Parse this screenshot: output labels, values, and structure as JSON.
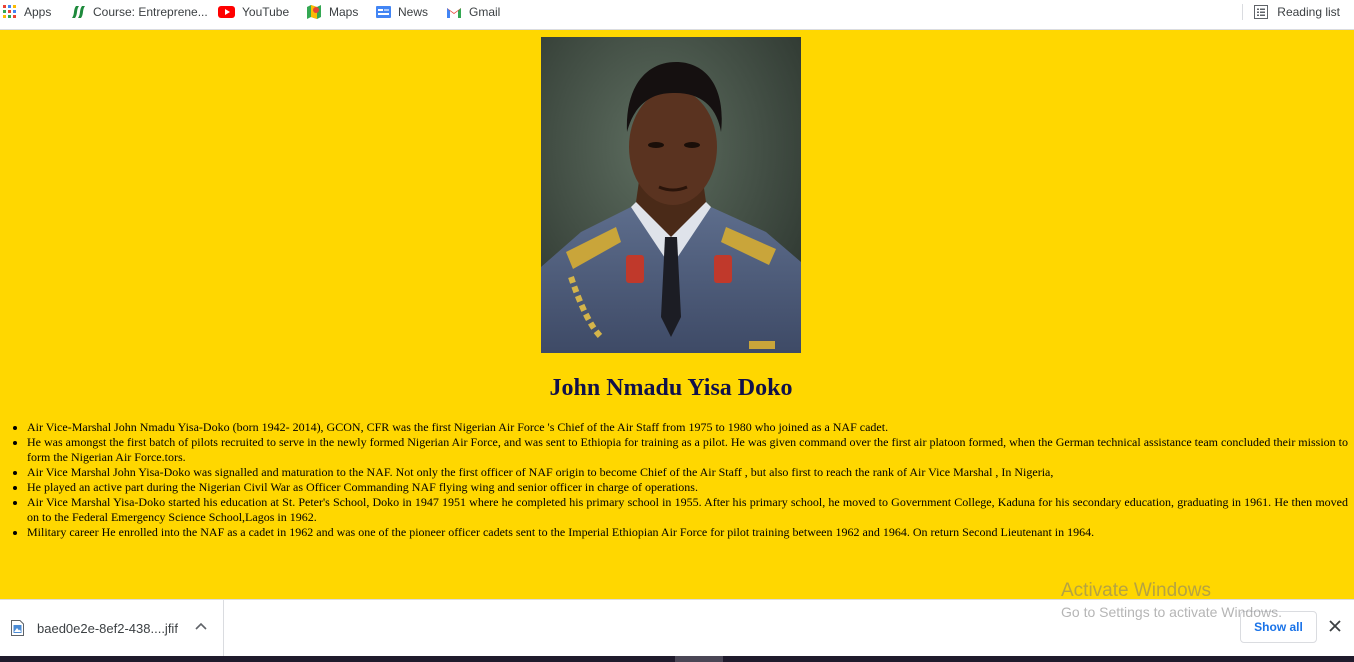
{
  "bookmarks_bar": {
    "items": [
      {
        "label": "Apps",
        "icon": "apps-grid-icon"
      },
      {
        "label": "Course: Entreprene...",
        "icon": "course-logo-icon"
      },
      {
        "label": "YouTube",
        "icon": "youtube-icon"
      },
      {
        "label": "Maps",
        "icon": "maps-icon"
      },
      {
        "label": "News",
        "icon": "news-icon"
      },
      {
        "label": "Gmail",
        "icon": "gmail-icon"
      }
    ],
    "reading_list": "Reading list"
  },
  "page": {
    "background": "#ffd700",
    "title": "John Nmadu Yisa Doko",
    "bio": [
      "Air Vice-Marshal John Nmadu Yisa-Doko (born 1942- 2014), GCON, CFR was the first Nigerian Air Force 's Chief of the Air Staff from 1975 to 1980 who joined as a NAF cadet.",
      "He was amongst the first batch of pilots recruited to serve in the newly formed Nigerian Air Force, and was sent to Ethiopia for training as a pilot. He was given command over the first air platoon formed, when the German technical assistance team concluded their mission to form the Nigerian Air Force.tors.",
      "Air Vice Marshal John Yisa-Doko was signalled and maturation to the NAF. Not only the first officer of NAF origin to become Chief of the Air Staff , but also first to reach the rank of Air Vice Marshal , In Nigeria,",
      "He played an active part during the Nigerian Civil War as Officer Commanding NAF flying wing and senior officer in charge of operations.",
      "Air Vice Marshal Yisa-Doko started his education at St. Peter's School, Doko in 1947 1951 where he completed his primary school in 1955. After his primary school, he moved to Government College, Kaduna for his secondary education, graduating in 1961. He then moved on to the Federal Emergency Science School,Lagos in 1962.",
      "Military career He enrolled into the NAF as a cadet in 1962 and was one of the pioneer officer cadets sent to the Imperial Ethiopian Air Force for pilot training between 1962 and 1964. On return Second Lieutenant in 1964."
    ]
  },
  "watermark": {
    "line1": "Activate Windows",
    "line2": "Go to Settings to activate Windows."
  },
  "download_shelf": {
    "file_name": "baed0e2e-8ef2-438....jfif",
    "show_all": "Show all"
  }
}
